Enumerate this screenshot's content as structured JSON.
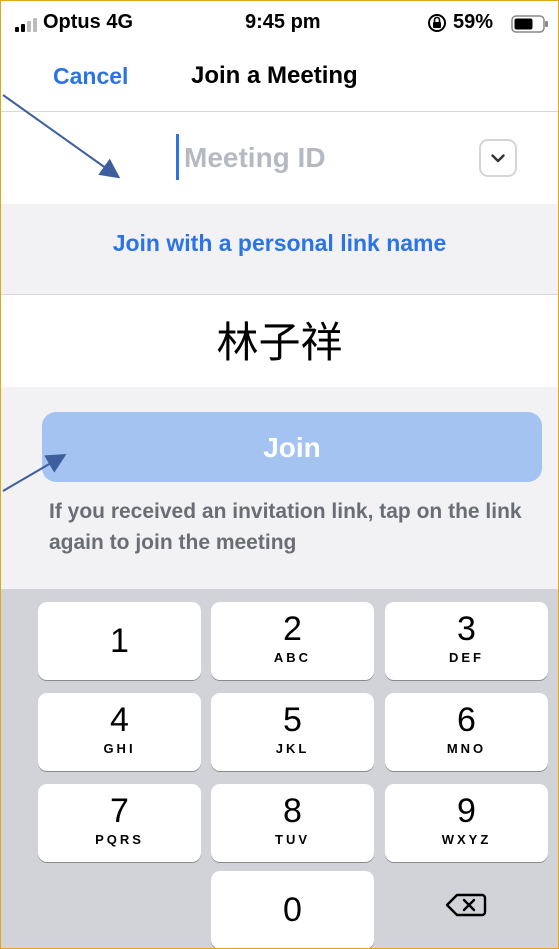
{
  "status_bar": {
    "carrier": "Optus  4G",
    "time": "9:45 pm",
    "battery": "59%"
  },
  "nav": {
    "cancel": "Cancel",
    "title": "Join a Meeting"
  },
  "meeting_id": {
    "placeholder": "Meeting ID",
    "value": ""
  },
  "personal_link": "Join with a personal link name",
  "name_field": "林子祥",
  "join_button": "Join",
  "hint": "If you received an invitation link, tap on the link again to join the meeting",
  "keypad": {
    "keys": [
      {
        "num": "1",
        "letters": ""
      },
      {
        "num": "2",
        "letters": "ABC"
      },
      {
        "num": "3",
        "letters": "DEF"
      },
      {
        "num": "4",
        "letters": "GHI"
      },
      {
        "num": "5",
        "letters": "JKL"
      },
      {
        "num": "6",
        "letters": "MNO"
      },
      {
        "num": "7",
        "letters": "PQRS"
      },
      {
        "num": "8",
        "letters": "TUV"
      },
      {
        "num": "9",
        "letters": "WXYZ"
      },
      {
        "num": "0",
        "letters": ""
      }
    ]
  },
  "colors": {
    "accent": "#2b73e6",
    "join_disabled": "#a4c3f0",
    "annotation_arrow": "#3e5f9e"
  }
}
